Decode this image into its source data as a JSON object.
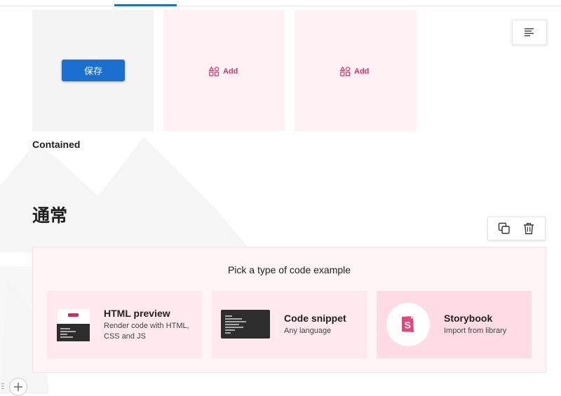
{
  "toolbar": {
    "active_tab_underline": true
  },
  "tiles": {
    "save_label": "保存",
    "add_label_1": "Add",
    "add_label_2": "Add"
  },
  "contained_label": "Contained",
  "section_heading": "通常",
  "code_example": {
    "title": "Pick a type of code example",
    "options": [
      {
        "title": "HTML preview",
        "desc": "Render code with HTML, CSS and JS",
        "icon": "html-preview-thumbnail"
      },
      {
        "title": "Code snippet",
        "desc": "Any language",
        "icon": "code-snippet-thumbnail"
      },
      {
        "title": "Storybook",
        "desc": "Import from library",
        "icon": "storybook-icon"
      }
    ]
  },
  "icons": {
    "menu": "text-align-left-icon",
    "copy": "copy-icon",
    "delete": "trash-icon",
    "add": "plus-icon",
    "add_tile": "shapes-add-icon"
  },
  "colors": {
    "primary_blue": "#1b6fd1",
    "accent_pink": "#d6336c",
    "panel_bg": "#fff4f6",
    "card_bg": "#ffe8ee"
  }
}
